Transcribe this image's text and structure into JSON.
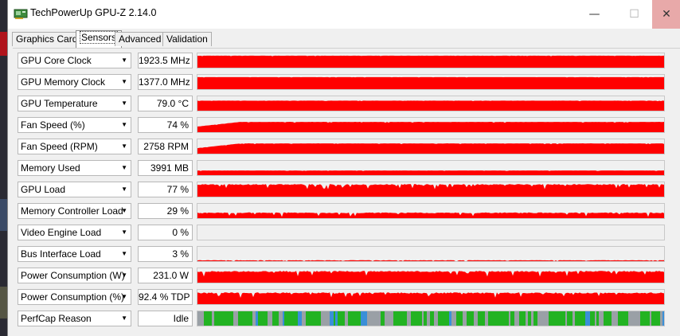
{
  "window": {
    "title": "TechPowerUp GPU-Z 2.14.0",
    "minimize_glyph": "—",
    "maximize_glyph": "☐",
    "close_glyph": "✕"
  },
  "tabs": [
    {
      "label": "Graphics Card",
      "active": false
    },
    {
      "label": "Sensors",
      "active": true
    },
    {
      "label": "Advanced",
      "active": false
    },
    {
      "label": "Validation",
      "active": false
    }
  ],
  "toolbar": {
    "camera_icon": "camera-icon",
    "refresh_icon": "refresh-icon"
  },
  "colors": {
    "graph_red": "#ff0000",
    "perfcap_green": "#22b322",
    "perfcap_grey": "#9aa0a6",
    "perfcap_blue": "#3a8fd8"
  },
  "sensors": [
    {
      "name": "GPU Core Clock",
      "value": "1923.5 MHz",
      "level": 0.84,
      "noise": 0.02,
      "color": "#ff0000"
    },
    {
      "name": "GPU Memory Clock",
      "value": "1377.0 MHz",
      "level": 0.84,
      "noise": 0.01,
      "color": "#ff0000"
    },
    {
      "name": "GPU Temperature",
      "value": "79.0 °C",
      "level": 0.7,
      "noise": 0.02,
      "color": "#ff0000"
    },
    {
      "name": "Fan Speed (%)",
      "value": "74 %",
      "level": 0.72,
      "noise": 0.03,
      "color": "#ff0000"
    },
    {
      "name": "Fan Speed (RPM)",
      "value": "2758 RPM",
      "level": 0.72,
      "noise": 0.03,
      "color": "#ff0000"
    },
    {
      "name": "Memory Used",
      "value": "3991 MB",
      "level": 0.33,
      "noise": 0.02,
      "color": "#ff0000"
    },
    {
      "name": "GPU Load",
      "value": "77 %",
      "level": 0.88,
      "noise": 0.18,
      "color": "#ff0000"
    },
    {
      "name": "Memory Controller Load",
      "value": "29 %",
      "level": 0.4,
      "noise": 0.15,
      "color": "#ff0000"
    },
    {
      "name": "Video Engine Load",
      "value": "0 %",
      "level": 0.0,
      "noise": 0.0,
      "color": "#ff0000"
    },
    {
      "name": "Bus Interface Load",
      "value": "3 %",
      "level": 0.07,
      "noise": 0.05,
      "color": "#ff0000"
    },
    {
      "name": "Power Consumption (W)",
      "value": "231.0 W",
      "level": 0.82,
      "noise": 0.2,
      "color": "#ff0000"
    },
    {
      "name": "Power Consumption (%)",
      "value": "92.4 % TDP",
      "level": 0.82,
      "noise": 0.2,
      "color": "#ff0000"
    },
    {
      "name": "PerfCap Reason",
      "value": "Idle",
      "level": 1.0,
      "noise": 0.0,
      "color": "perfcap"
    }
  ]
}
